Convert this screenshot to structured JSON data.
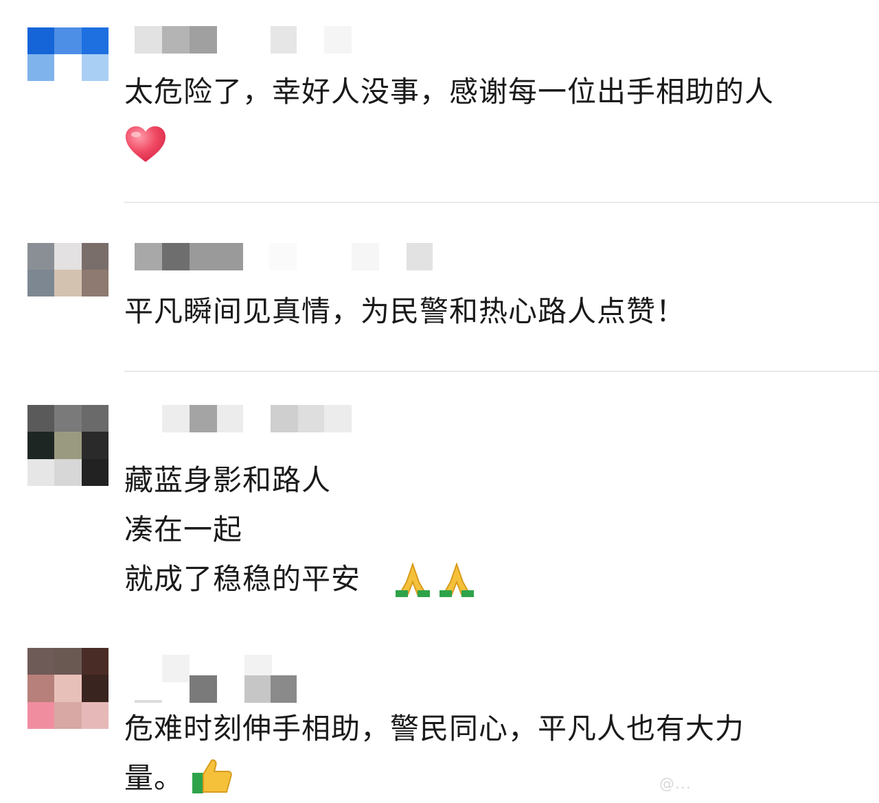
{
  "comments": [
    {
      "text_lines": [
        "太危险了，幸好人没事，感谢每一位出手相助的人"
      ],
      "trailing_emoji": "red-heart",
      "avatar_colors": [
        "#1565d8",
        "#4d8fe6",
        "#1e6fe0",
        "#7fb3ec",
        "#ffffff",
        "#a9cff4"
      ]
    },
    {
      "text_lines": [
        "平凡瞬间见真情，为民警和热心路人点赞！"
      ],
      "avatar_colors": [
        "#8a8f96",
        "#e3e1e1",
        "#7a6e6b",
        "#7c8792",
        "#d4c2b0",
        "#8e7a70"
      ]
    },
    {
      "text_lines": [
        "藏蓝身影和路人",
        "凑在一起",
        "就成了稳稳的平安"
      ],
      "trailing_emoji": "folded-hands x2",
      "avatar_colors": [
        "#5a5a5a",
        "#7a7a7a",
        "#6a6a6a",
        "#1e2624",
        "#9a9a80",
        "#2a2a2a",
        "#e6e6e6",
        "#d7d7d7",
        "#222222"
      ]
    },
    {
      "text_lines": [
        "危难时刻伸手相助，警民同心，平凡人也有大力",
        "量。"
      ],
      "trailing_emoji": "thumbs-up",
      "avatar_colors": [
        "#6e5a56",
        "#6a5853",
        "#4a2c26",
        "#b8807a",
        "#e8c0ba",
        "#3a2420",
        "#f08ea0",
        "#d8a8a4",
        "#e6b8b8"
      ]
    }
  ],
  "watermark": "@..."
}
